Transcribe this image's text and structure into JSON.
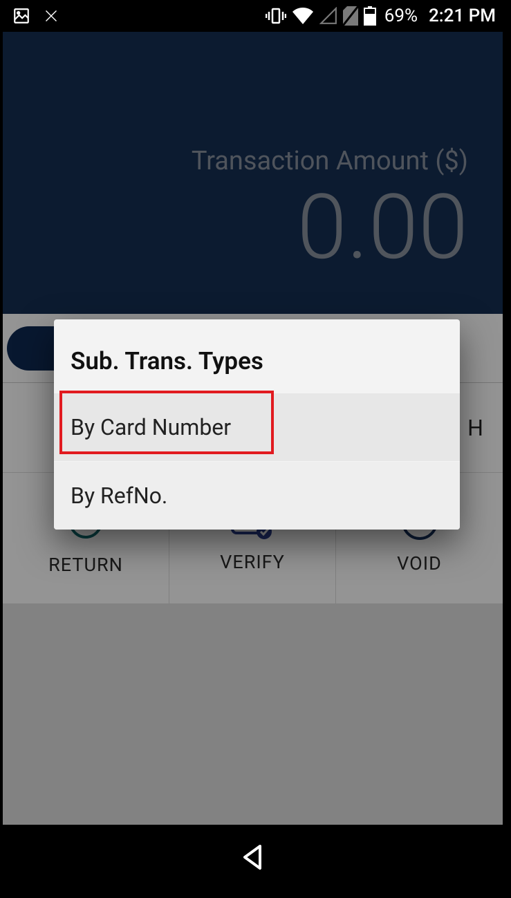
{
  "status": {
    "battery_pct": "69%",
    "time": "2:21 PM"
  },
  "amount": {
    "label": "Transaction Amount ($)",
    "value": "0.00"
  },
  "actions": {
    "return": "RETURN",
    "verify": "VERIFY",
    "void": "VOID"
  },
  "dialog": {
    "title": "Sub. Trans. Types",
    "option1": "By Card Number",
    "option2": "By RefNo."
  }
}
